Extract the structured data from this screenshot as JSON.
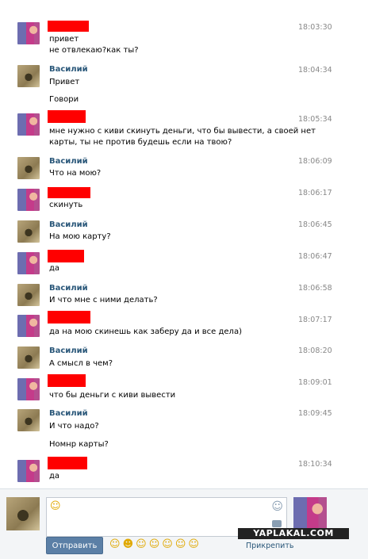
{
  "messages": [
    {
      "sender": "redacted",
      "time": "18:03:30",
      "lines": [
        "привет",
        "не отвлекаю?как ты?"
      ]
    },
    {
      "sender": "Василий",
      "time": "18:04:34",
      "lines": [
        "Привет",
        "",
        "Говори"
      ]
    },
    {
      "sender": "redacted",
      "time": "18:05:34",
      "lines": [
        "мне нужно с киви скинуть деньги, что бы вывести, а своей нет",
        "карты, ты не против будешь если на твою?"
      ]
    },
    {
      "sender": "Василий",
      "time": "18:06:09",
      "lines": [
        "Что на мою?"
      ]
    },
    {
      "sender": "redacted",
      "time": "18:06:17",
      "lines": [
        "скинуть"
      ]
    },
    {
      "sender": "Василий",
      "time": "18:06:45",
      "lines": [
        "На мою карту?"
      ]
    },
    {
      "sender": "redacted",
      "time": "18:06:47",
      "lines": [
        "да"
      ]
    },
    {
      "sender": "Василий",
      "time": "18:06:58",
      "lines": [
        "И что мне с ними делать?"
      ]
    },
    {
      "sender": "redacted",
      "time": "18:07:17",
      "lines": [
        "да на мою скинешь как заберу да и все дела)"
      ]
    },
    {
      "sender": "Василий",
      "time": "18:08:20",
      "lines": [
        "А смысл в чем?"
      ]
    },
    {
      "sender": "redacted",
      "time": "18:09:01",
      "lines": [
        "что бы деньги с киви вывести"
      ]
    },
    {
      "sender": "Василий",
      "time": "18:09:45",
      "lines": [
        "И что надо?",
        "",
        "Номнр карты?"
      ]
    },
    {
      "sender": "redacted",
      "time": "18:10:34",
      "lines": [
        "да"
      ]
    }
  ],
  "composer": {
    "send_label": "Отправить",
    "attach_label": "Прикрепить",
    "input_emoji": "☺",
    "smile_icon": "smile-icon",
    "emoji_bar": [
      "☺",
      "☻",
      "☺",
      "☺",
      "☺",
      "☺",
      "☺"
    ]
  },
  "watermark": "YAPLAKAL.COM",
  "colors": {
    "name": "#2b587a",
    "redact": "#ff0000",
    "send": "#5b7fa6",
    "time": "#888888"
  }
}
